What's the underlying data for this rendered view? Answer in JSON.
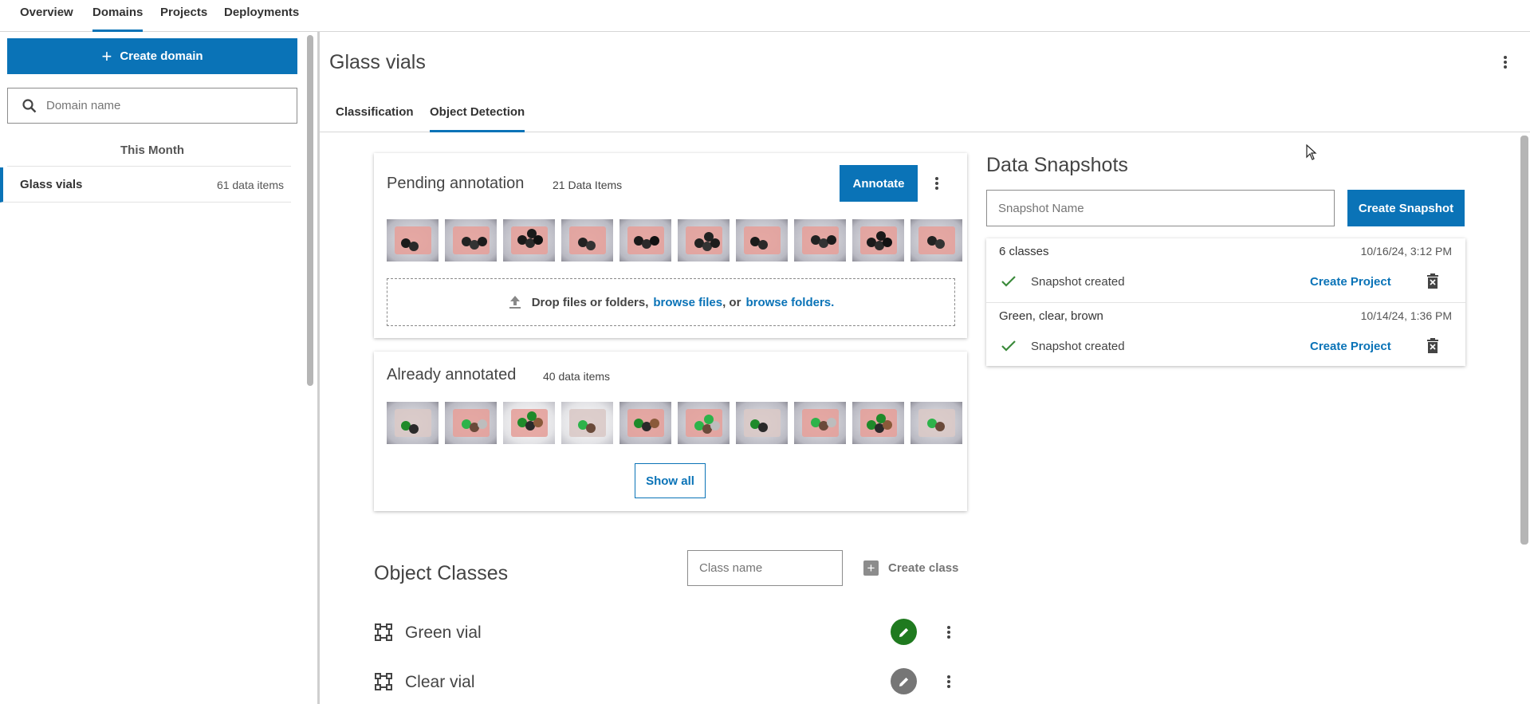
{
  "nav": {
    "tabs": [
      "Overview",
      "Domains",
      "Projects",
      "Deployments"
    ],
    "active_tab": "Domains"
  },
  "sidebar": {
    "create_label": "Create domain",
    "search_placeholder": "Domain name",
    "group_label": "This Month",
    "items": [
      {
        "name": "Glass vials",
        "count": "61 data items"
      }
    ]
  },
  "page": {
    "title": "Glass vials",
    "tabs": [
      "Classification",
      "Object Detection"
    ],
    "active_tab": "Object Detection"
  },
  "pending": {
    "title": "Pending annotation",
    "count": "21 Data Items",
    "annotate_label": "Annotate",
    "drop_text": "Drop files or folders,",
    "browse_files": "browse files",
    "or_text": ", or",
    "browse_folders": "browse folders."
  },
  "annotated": {
    "title": "Already annotated",
    "count": "40 data items",
    "show_all_label": "Show all"
  },
  "classes": {
    "title": "Object Classes",
    "input_placeholder": "Class name",
    "create_label": "Create class",
    "items": [
      {
        "name": "Green vial",
        "color": "#1f7a1f"
      },
      {
        "name": "Clear vial",
        "color": "#767676"
      }
    ]
  },
  "snapshots": {
    "title": "Data Snapshots",
    "input_placeholder": "Snapshot Name",
    "create_label": "Create Snapshot",
    "items": [
      {
        "name": "6 classes",
        "date": "10/16/24, 3:12 PM",
        "status": "Snapshot created",
        "action": "Create Project"
      },
      {
        "name": "Green, clear, brown",
        "date": "10/14/24, 1:36 PM",
        "status": "Snapshot created",
        "action": "Create Project"
      }
    ]
  },
  "colors": {
    "accent": "#0a73b7",
    "success": "#3a8a3a"
  }
}
